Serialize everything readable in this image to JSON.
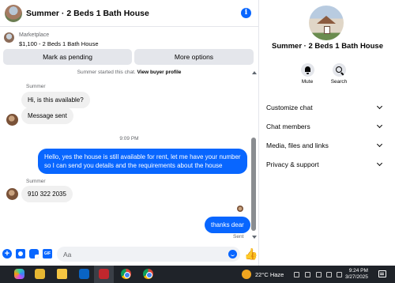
{
  "header": {
    "title": "Summer · 2 Beds 1 Bath House"
  },
  "listing": {
    "source": "Marketplace",
    "item": "$1,100 - 2 Beds 1 Bath House",
    "pending_label": "Mark as pending",
    "more_label": "More options"
  },
  "conversation": {
    "system_note": "Summer started this chat.",
    "system_link": "View buyer profile",
    "sender_1": "Summer",
    "msg_1": "Hi, is this available?",
    "msg_2": "Message sent",
    "timestamp": "9:09 PM",
    "msg_3": "Hello, yes the house is still available for rent, let me have your number so I can send you details and the requirements about the house",
    "sender_2": "Summer",
    "msg_4": "910 322 2035",
    "msg_5": "thanks dear",
    "status": "Sent"
  },
  "composer": {
    "placeholder": "Aa"
  },
  "sidebar": {
    "name": "Summer · 2 Beds 1 Bath House",
    "mute_label": "Mute",
    "search_label": "Search",
    "menu": [
      "Customize chat",
      "Chat members",
      "Media, files and links",
      "Privacy & support"
    ]
  },
  "taskbar": {
    "weather": "22°C  Haze",
    "time": "9:24 PM",
    "date": "3/27/2025"
  },
  "colors": {
    "accent": "#0866ff",
    "bubble_in": "#f0f0f0",
    "taskbar": "#1f2329"
  },
  "icons": [
    "info-icon",
    "plus-icon",
    "camera-icon",
    "sticker-icon",
    "gif-icon",
    "emoji-icon",
    "like-icon",
    "bell-icon",
    "search-icon",
    "chevron-down-icon"
  ]
}
